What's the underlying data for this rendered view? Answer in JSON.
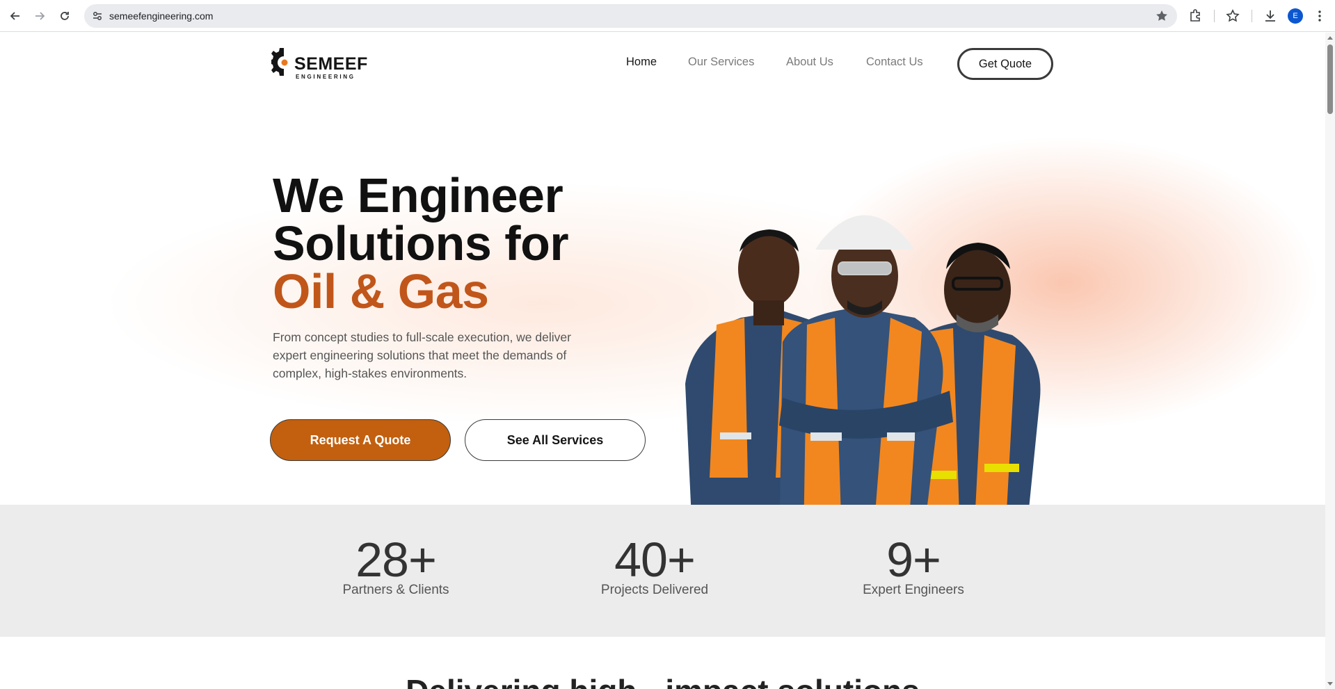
{
  "browser": {
    "url": "semeefengineering.com",
    "profile_initial": "E"
  },
  "header": {
    "logo_brand": "SEMEEF",
    "logo_sub": "ENGINEERING",
    "nav": [
      "Home",
      "Our Services",
      "About Us",
      "Contact Us"
    ],
    "active_index": 0,
    "cta": "Get Quote"
  },
  "hero": {
    "title_line1": "We Engineer",
    "title_line2": "Solutions for",
    "title_accent": "Oil & Gas",
    "description": "From concept studies to full-scale execution, we deliver expert engineering solutions that meet the demands of complex, high-stakes environments.",
    "primary_button": "Request A Quote",
    "secondary_button": "See All Services"
  },
  "stats": [
    {
      "value": "28+",
      "label": "Partners & Clients"
    },
    {
      "value": "40+",
      "label": "Projects Delivered"
    },
    {
      "value": "9+",
      "label": "Expert Engineers"
    }
  ],
  "next_section_heading": "Delivering high - impact solutions",
  "colors": {
    "accent": "#c1561a",
    "button_primary": "#c2600f",
    "stats_bg": "#ececec"
  }
}
